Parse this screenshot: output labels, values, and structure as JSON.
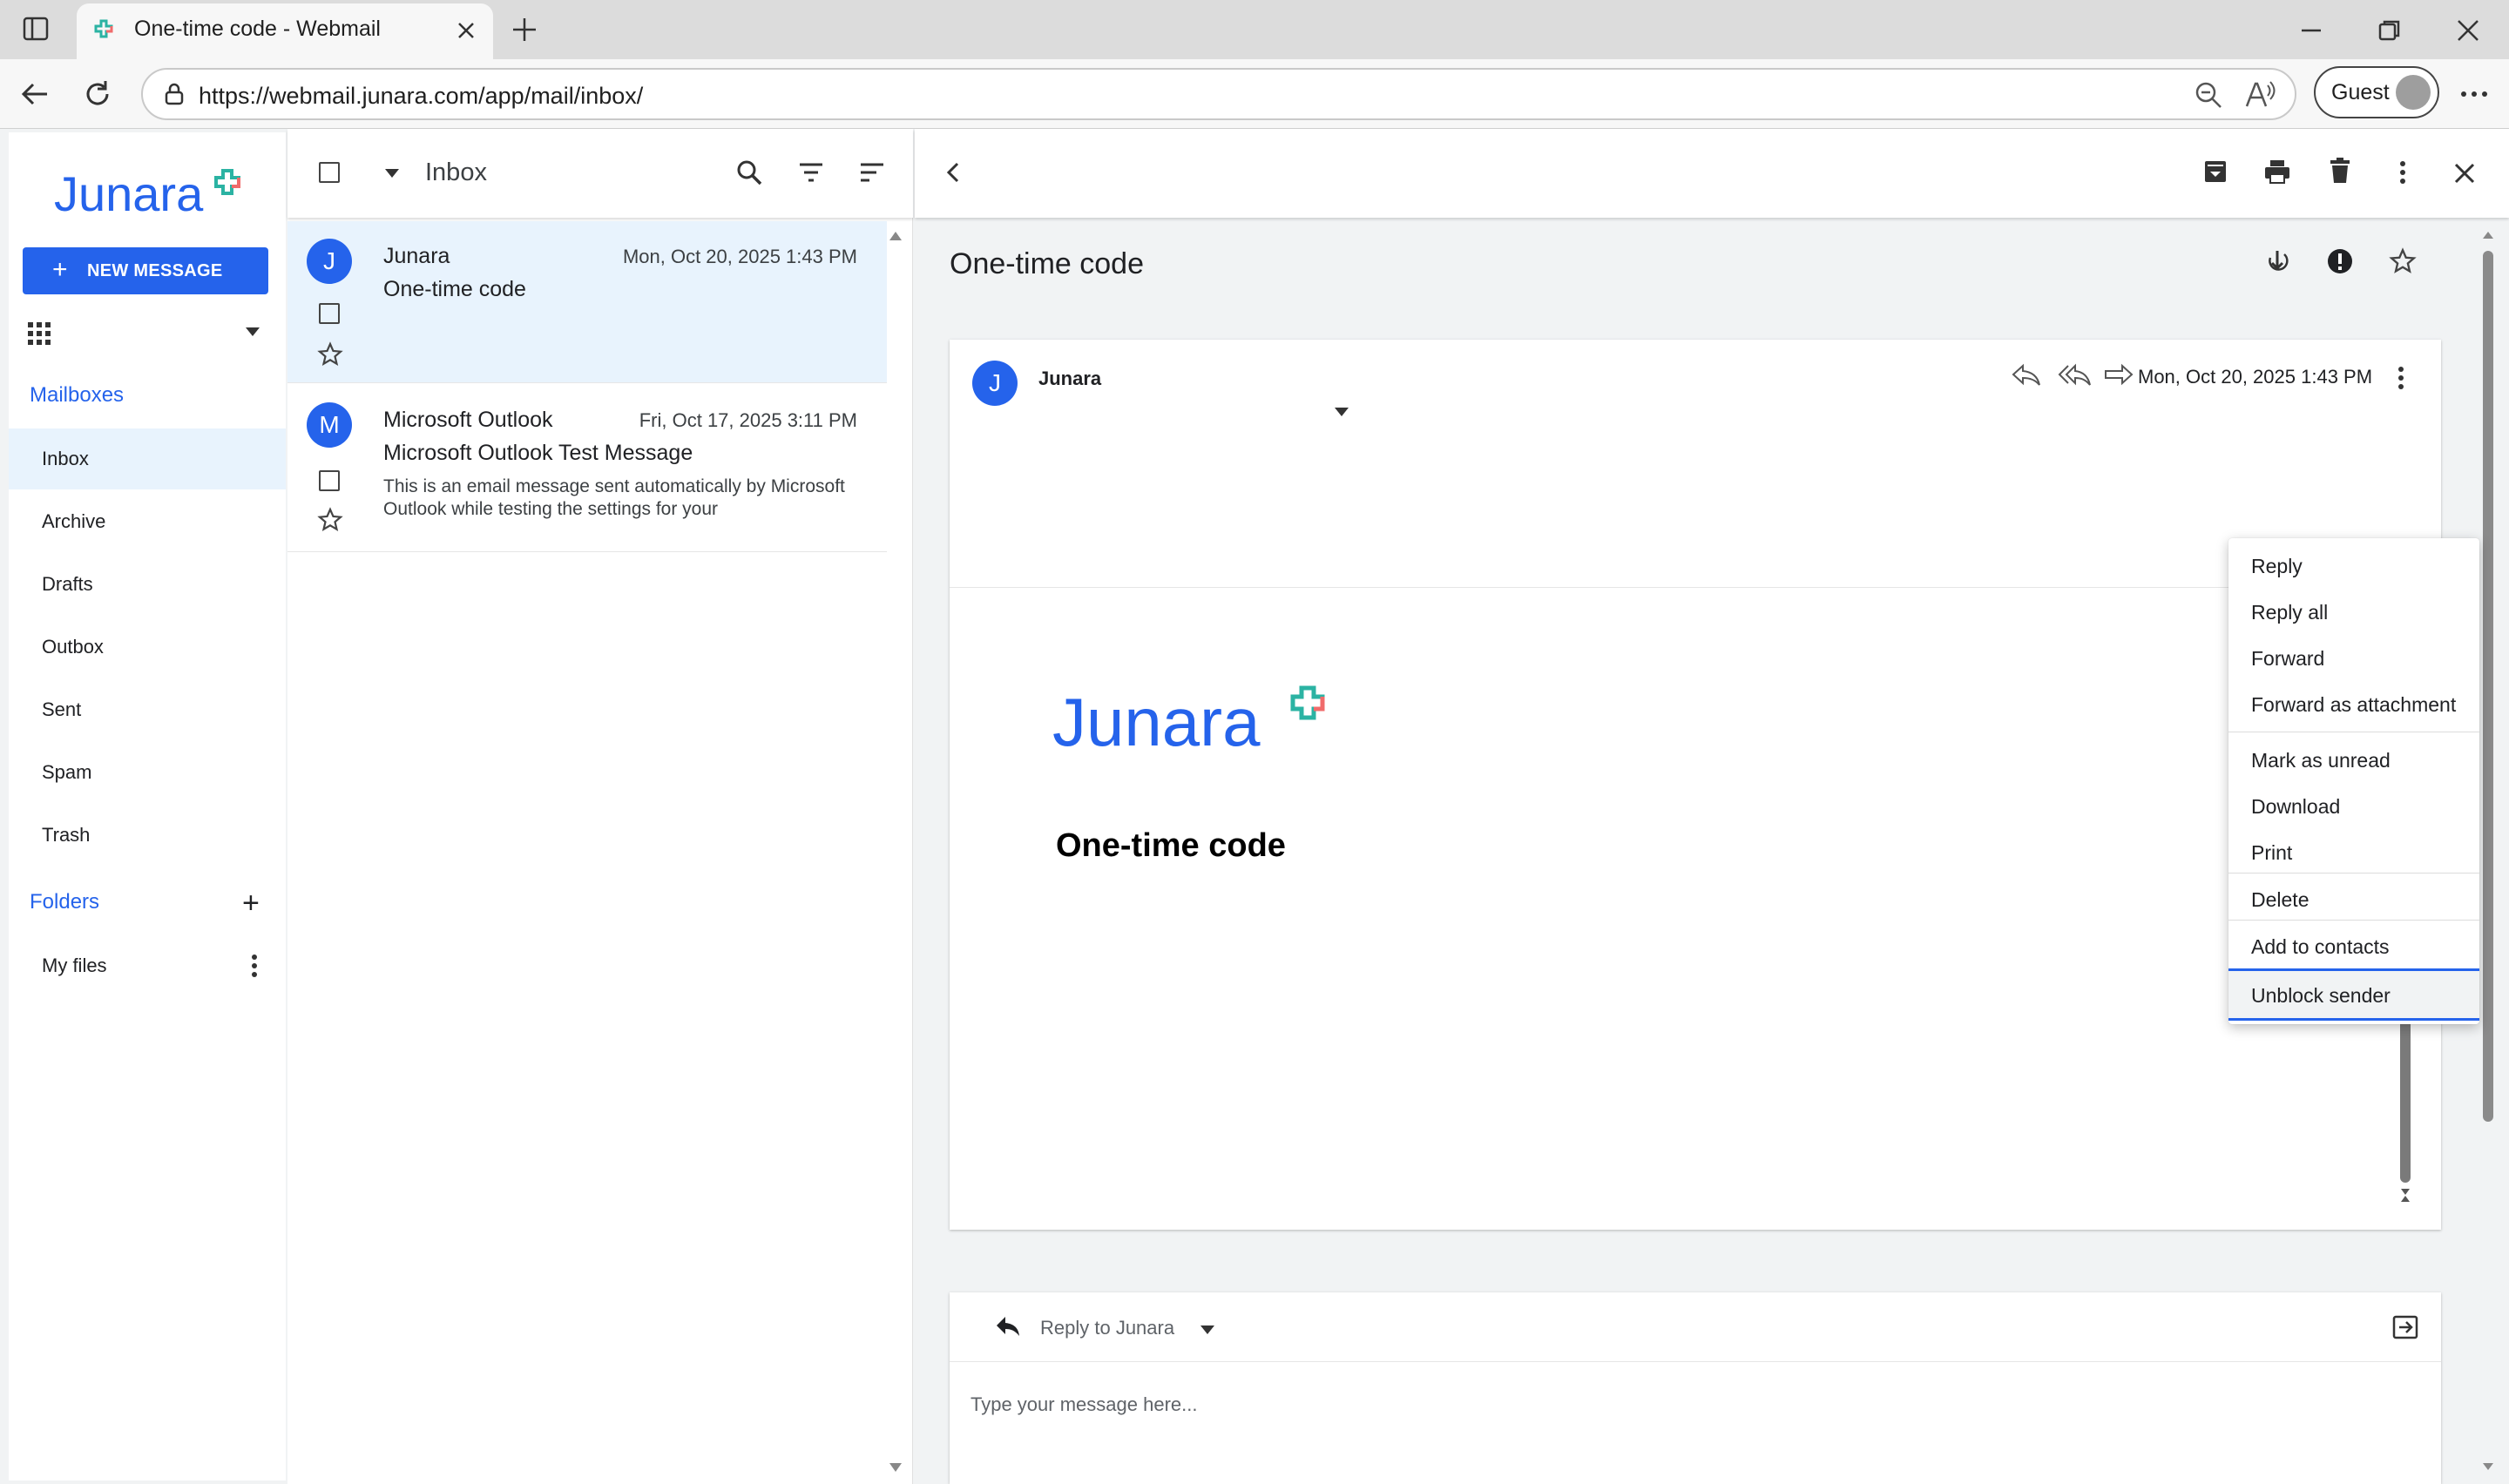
{
  "browser": {
    "tab_title": "One-time code - Webmail",
    "url": "https://webmail.junara.com/app/mail/inbox/",
    "profile_label": "Guest"
  },
  "brand": {
    "name": "Junara",
    "primary_color": "#2563eb"
  },
  "sidebar": {
    "new_message_label": "NEW MESSAGE",
    "mailboxes_title": "Mailboxes",
    "mailboxes": [
      "Inbox",
      "Archive",
      "Drafts",
      "Outbox",
      "Sent",
      "Spam",
      "Trash"
    ],
    "selected_mailbox": "Inbox",
    "folders_title": "Folders",
    "folders": [
      "My files"
    ]
  },
  "list": {
    "title": "Inbox",
    "messages": [
      {
        "avatar": "J",
        "from": "Junara",
        "date": "Mon, Oct 20, 2025 1:43 PM",
        "subject": "One-time code",
        "preview": ""
      },
      {
        "avatar": "M",
        "from": "Microsoft Outlook",
        "date": "Fri, Oct 17, 2025 3:11 PM",
        "subject": "Microsoft Outlook Test Message",
        "preview": "This is an email message sent automatically by Microsoft Outlook while testing the settings for your"
      }
    ]
  },
  "reader": {
    "subject": "One-time code",
    "sender_avatar": "J",
    "sender": "Junara",
    "date": "Mon, Oct 20, 2025 1:43 PM",
    "body_logo": "Junara",
    "body_title": "One-time code",
    "reply_to_label": "Reply to Junara",
    "reply_placeholder": "Type your message here..."
  },
  "context_menu": {
    "items": [
      "Reply",
      "Reply all",
      "Forward",
      "Forward as attachment",
      "Mark as unread",
      "Download",
      "Print",
      "Delete",
      "Add to contacts",
      "Unblock sender"
    ],
    "highlighted": "Unblock sender"
  }
}
